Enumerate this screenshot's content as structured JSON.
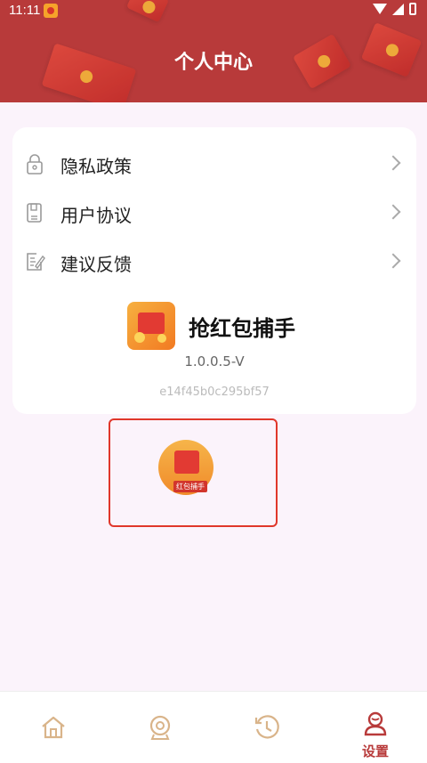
{
  "status_bar": {
    "time": "11:11"
  },
  "header": {
    "title": "个人中心"
  },
  "menu": [
    {
      "label": "隐私政策",
      "icon": "lock-icon"
    },
    {
      "label": "用户协议",
      "icon": "document-icon"
    },
    {
      "label": "建议反馈",
      "icon": "feedback-edit-icon"
    }
  ],
  "app_info": {
    "name": "抢红包捕手",
    "version": "1.0.0.5-V",
    "hash": "e14f45b0c295bf57",
    "icon": "red-envelope-app-icon"
  },
  "badge": {
    "label": "红包捕手",
    "icon": "red-envelope-badge-icon"
  },
  "bottom_nav": {
    "tabs": [
      {
        "label": "",
        "icon": "home-icon"
      },
      {
        "label": "",
        "icon": "camera-icon"
      },
      {
        "label": "",
        "icon": "history-clock-icon"
      },
      {
        "label": "设置",
        "icon": "settings-person-icon",
        "active": true
      }
    ]
  },
  "colors": {
    "header": "#b83a3a",
    "accent": "#b83a3a",
    "highlight": "#e0372b",
    "background": "#fbf3fb"
  }
}
